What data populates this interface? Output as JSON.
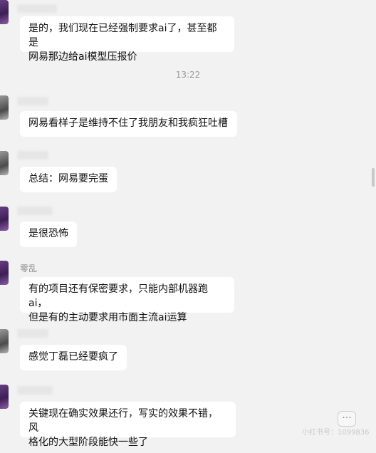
{
  "chat": {
    "timestamp": "13:22",
    "messages": [
      {
        "sender": "",
        "text": "是的，我们现在已经强制要求ai了，甚至都是\n网易那边给ai模型压报价"
      },
      {
        "sender": "",
        "text": "网易看样子是维持不住了我朋友和我疯狂吐槽"
      },
      {
        "sender": "",
        "text": "总结：网易要完蛋"
      },
      {
        "sender": "",
        "text": "是很恐怖"
      },
      {
        "sender": "零乱",
        "text": "有的项目还有保密要求，只能内部机器跑ai，\n但是有的主动要求用市面主流ai运算"
      },
      {
        "sender": "",
        "text": "感觉丁磊已经要疯了"
      },
      {
        "sender": "",
        "text": "关键现在确实效果还行，写实的效果不错，风\n格化的大型阶段能快一些了"
      }
    ],
    "more_button": "···",
    "watermark": "小红书号：1099836"
  }
}
